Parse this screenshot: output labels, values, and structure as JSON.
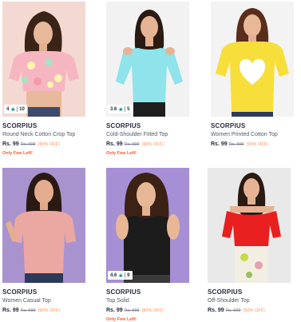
{
  "products": [
    {
      "brand": "SCORPIUS",
      "title": "Round Neck Cotton Crop Top",
      "price": "Rs. 99",
      "mrp": "Rs. 999",
      "discount": "(90% OFF)",
      "urgency": "Only Few Left!",
      "rating": "4",
      "rating_count": "10",
      "image_bg": "#f4d9d2",
      "garment_color": "#f6b6c1"
    },
    {
      "brand": "SCORPIUS",
      "title": "Cold-Shoulder Fitted Top",
      "price": "Rs. 99",
      "mrp": "Rs. 999",
      "discount": "(90% OFF)",
      "urgency": "Only Few Left!",
      "rating": "3.6",
      "rating_count": "5",
      "image_bg": "#f2f2f2",
      "garment_color": "#8fe3ea"
    },
    {
      "brand": "SCORPIUS",
      "title": "Women Printed Cotton Top",
      "price": "Rs. 99",
      "mrp": "Rs. 999",
      "discount": "(90% OFF)",
      "urgency": "",
      "rating": "",
      "rating_count": "",
      "image_bg": "#f3f3f3",
      "garment_color": "#f7de3a"
    },
    {
      "brand": "SCORPIUS",
      "title": "Women Casual Top",
      "price": "Rs. 99",
      "mrp": "Rs. 999",
      "discount": "(90% OFF)",
      "urgency": "",
      "rating": "",
      "rating_count": "",
      "image_bg": "#a993cf",
      "garment_color": "#eba7a1"
    },
    {
      "brand": "SCORPIUS",
      "title": "Top Solid",
      "price": "Rs. 99",
      "mrp": "Rs. 999",
      "discount": "(90% OFF)",
      "urgency": "Only Few Left!",
      "rating": "4.6",
      "rating_count": "9",
      "image_bg": "#a68fd4",
      "garment_color": "#1c1c1c"
    },
    {
      "brand": "SCORPIUS",
      "title": "Off-Shoulder Top",
      "price": "Rs. 99",
      "mrp": "Rs. 999",
      "discount": "(90% OFF)",
      "urgency": "",
      "rating": "",
      "rating_count": "",
      "image_bg": "#e9e9e9",
      "garment_color": "#e8201f"
    }
  ]
}
